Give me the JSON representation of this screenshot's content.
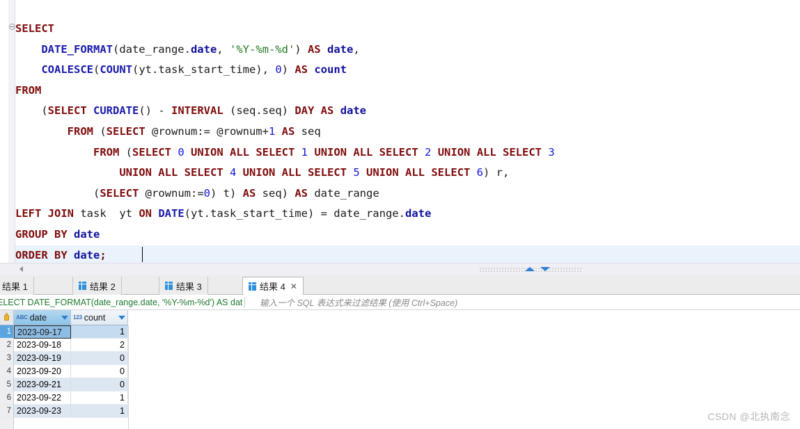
{
  "editor": {
    "fold_marker": "collapse-fold",
    "lines": [
      [
        {
          "t": "SELECT",
          "c": "kw"
        }
      ],
      [
        {
          "t": "    ",
          "c": "pl"
        },
        {
          "t": "DATE_FORMAT",
          "c": "fn"
        },
        {
          "t": "(date_range.",
          "c": "pl"
        },
        {
          "t": "date",
          "c": "idb"
        },
        {
          "t": ", ",
          "c": "pl"
        },
        {
          "t": "'%Y-%m-%d'",
          "c": "str"
        },
        {
          "t": ") ",
          "c": "pl"
        },
        {
          "t": "AS",
          "c": "kw"
        },
        {
          "t": " ",
          "c": "pl"
        },
        {
          "t": "date",
          "c": "idb"
        },
        {
          "t": ",",
          "c": "pl"
        }
      ],
      [
        {
          "t": "    ",
          "c": "pl"
        },
        {
          "t": "COALESCE",
          "c": "fn"
        },
        {
          "t": "(",
          "c": "pl"
        },
        {
          "t": "COUNT",
          "c": "fn"
        },
        {
          "t": "(yt.task_start_time), ",
          "c": "pl"
        },
        {
          "t": "0",
          "c": "num"
        },
        {
          "t": ") ",
          "c": "pl"
        },
        {
          "t": "AS",
          "c": "kw"
        },
        {
          "t": " ",
          "c": "pl"
        },
        {
          "t": "count",
          "c": "idb"
        }
      ],
      [
        {
          "t": "FROM",
          "c": "kw"
        }
      ],
      [
        {
          "t": "    (",
          "c": "pl"
        },
        {
          "t": "SELECT",
          "c": "kw"
        },
        {
          "t": " ",
          "c": "pl"
        },
        {
          "t": "CURDATE",
          "c": "fn"
        },
        {
          "t": "() - ",
          "c": "pl"
        },
        {
          "t": "INTERVAL",
          "c": "kw"
        },
        {
          "t": " (seq.seq) ",
          "c": "pl"
        },
        {
          "t": "DAY",
          "c": "kw"
        },
        {
          "t": " ",
          "c": "pl"
        },
        {
          "t": "AS",
          "c": "kw"
        },
        {
          "t": " ",
          "c": "pl"
        },
        {
          "t": "date",
          "c": "idb"
        }
      ],
      [
        {
          "t": "        ",
          "c": "pl"
        },
        {
          "t": "FROM",
          "c": "kw"
        },
        {
          "t": " (",
          "c": "pl"
        },
        {
          "t": "SELECT",
          "c": "kw"
        },
        {
          "t": " @rownum:= @rownum+",
          "c": "pl"
        },
        {
          "t": "1",
          "c": "num"
        },
        {
          "t": " ",
          "c": "pl"
        },
        {
          "t": "AS",
          "c": "kw"
        },
        {
          "t": " seq",
          "c": "pl"
        }
      ],
      [
        {
          "t": "            ",
          "c": "pl"
        },
        {
          "t": "FROM",
          "c": "kw"
        },
        {
          "t": " (",
          "c": "pl"
        },
        {
          "t": "SELECT",
          "c": "kw"
        },
        {
          "t": " ",
          "c": "pl"
        },
        {
          "t": "0",
          "c": "num"
        },
        {
          "t": " ",
          "c": "pl"
        },
        {
          "t": "UNION ALL SELECT",
          "c": "kw"
        },
        {
          "t": " ",
          "c": "pl"
        },
        {
          "t": "1",
          "c": "num"
        },
        {
          "t": " ",
          "c": "pl"
        },
        {
          "t": "UNION ALL SELECT",
          "c": "kw"
        },
        {
          "t": " ",
          "c": "pl"
        },
        {
          "t": "2",
          "c": "num"
        },
        {
          "t": " ",
          "c": "pl"
        },
        {
          "t": "UNION ALL SELECT",
          "c": "kw"
        },
        {
          "t": " ",
          "c": "pl"
        },
        {
          "t": "3",
          "c": "num"
        }
      ],
      [
        {
          "t": "                ",
          "c": "pl"
        },
        {
          "t": "UNION ALL SELECT",
          "c": "kw"
        },
        {
          "t": " ",
          "c": "pl"
        },
        {
          "t": "4",
          "c": "num"
        },
        {
          "t": " ",
          "c": "pl"
        },
        {
          "t": "UNION ALL SELECT",
          "c": "kw"
        },
        {
          "t": " ",
          "c": "pl"
        },
        {
          "t": "5",
          "c": "num"
        },
        {
          "t": " ",
          "c": "pl"
        },
        {
          "t": "UNION ALL SELECT",
          "c": "kw"
        },
        {
          "t": " ",
          "c": "pl"
        },
        {
          "t": "6",
          "c": "num"
        },
        {
          "t": ") r,",
          "c": "pl"
        }
      ],
      [
        {
          "t": "            (",
          "c": "pl"
        },
        {
          "t": "SELECT",
          "c": "kw"
        },
        {
          "t": " @rownum:=",
          "c": "pl"
        },
        {
          "t": "0",
          "c": "num"
        },
        {
          "t": ") t) ",
          "c": "pl"
        },
        {
          "t": "AS",
          "c": "kw"
        },
        {
          "t": " seq) ",
          "c": "pl"
        },
        {
          "t": "AS",
          "c": "kw"
        },
        {
          "t": " date_range",
          "c": "pl"
        }
      ],
      [
        {
          "t": "LEFT JOIN",
          "c": "kw"
        },
        {
          "t": " task  yt ",
          "c": "pl"
        },
        {
          "t": "ON",
          "c": "kw"
        },
        {
          "t": " ",
          "c": "pl"
        },
        {
          "t": "DATE",
          "c": "fn"
        },
        {
          "t": "(yt.task_start_time) = date_range.",
          "c": "pl"
        },
        {
          "t": "date",
          "c": "idb"
        }
      ],
      [
        {
          "t": "GROUP BY",
          "c": "kw"
        },
        {
          "t": " ",
          "c": "pl"
        },
        {
          "t": "date",
          "c": "idb"
        }
      ],
      [
        {
          "t": "ORDER BY",
          "c": "kw"
        },
        {
          "t": " ",
          "c": "pl"
        },
        {
          "t": "date",
          "c": "idb"
        },
        {
          "t": ";",
          "c": "kw"
        }
      ]
    ]
  },
  "splitter": {
    "collapse_left_icon": "chevron-left-icon",
    "up_icon": "chevron-up-icon",
    "down_icon": "chevron-down-icon"
  },
  "tabs": [
    {
      "label": "结果 1",
      "active": false,
      "icon": "grid-icon",
      "closable": false
    },
    {
      "label": "结果 2",
      "active": false,
      "icon": "grid-icon",
      "closable": false
    },
    {
      "label": "结果 3",
      "active": false,
      "icon": "grid-icon",
      "closable": false
    },
    {
      "label": "结果 4",
      "active": true,
      "icon": "grid-icon",
      "closable": true,
      "close_label": "✕"
    }
  ],
  "filter_bar": {
    "query_text": "ELECT DATE_FORMAT(date_range.date, '%Y-%m-%d') AS dat",
    "expand_icon": "expand-icon",
    "placeholder": "输入一个 SQL 表达式来过滤结果 (使用 Ctrl+Space)"
  },
  "grid": {
    "lock_icon": "lock-icon",
    "columns": [
      {
        "name": "date",
        "type_badge": "ABC",
        "sort_icon": "chevron-down-icon"
      },
      {
        "name": "count",
        "type_badge": "123",
        "sort_icon": "chevron-down-icon"
      }
    ],
    "rows": [
      {
        "n": "1",
        "date": "2023-09-17",
        "count": "1"
      },
      {
        "n": "2",
        "date": "2023-09-18",
        "count": "2"
      },
      {
        "n": "3",
        "date": "2023-09-19",
        "count": "0"
      },
      {
        "n": "4",
        "date": "2023-09-20",
        "count": "0"
      },
      {
        "n": "5",
        "date": "2023-09-21",
        "count": "0"
      },
      {
        "n": "6",
        "date": "2023-09-22",
        "count": "1"
      },
      {
        "n": "7",
        "date": "2023-09-23",
        "count": "1"
      }
    ]
  },
  "watermark": {
    "text": "CSDN @北执南念"
  }
}
